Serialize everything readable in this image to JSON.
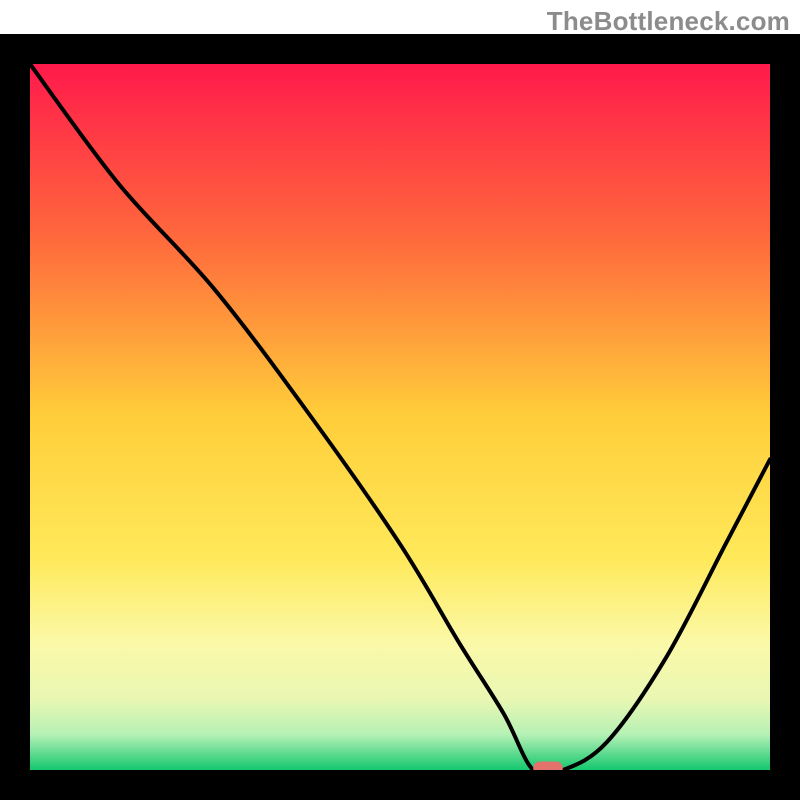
{
  "watermark": "TheBottleneck.com",
  "chart_data": {
    "type": "line",
    "title": "",
    "xlabel": "",
    "ylabel": "",
    "xlim": [
      0,
      100
    ],
    "ylim": [
      0,
      100
    ],
    "grid": false,
    "legend_visible": false,
    "gradient_stops": [
      {
        "offset": 0.0,
        "color": "#ff1a4b"
      },
      {
        "offset": 0.25,
        "color": "#ff6a3c"
      },
      {
        "offset": 0.5,
        "color": "#ffce3a"
      },
      {
        "offset": 0.7,
        "color": "#ffe95a"
      },
      {
        "offset": 0.82,
        "color": "#fbf9a8"
      },
      {
        "offset": 0.9,
        "color": "#e9f7b3"
      },
      {
        "offset": 0.95,
        "color": "#b5f1b5"
      },
      {
        "offset": 1.0,
        "color": "#13c76e"
      }
    ],
    "curve": {
      "note": "y is bottleneck-style deviation (%) read off the plot; 0 at the minimum near x≈70",
      "x": [
        0,
        12,
        25,
        38,
        50,
        58,
        64,
        68,
        72,
        78,
        86,
        94,
        100
      ],
      "y": [
        100,
        83,
        68,
        50,
        32,
        18,
        8,
        0,
        0,
        4,
        16,
        32,
        44
      ]
    },
    "marker": {
      "x": 70,
      "y": 0,
      "width_pct": 4,
      "color": "#e2726b"
    },
    "frame_color": "#000000",
    "frame_thickness_px": 30
  }
}
